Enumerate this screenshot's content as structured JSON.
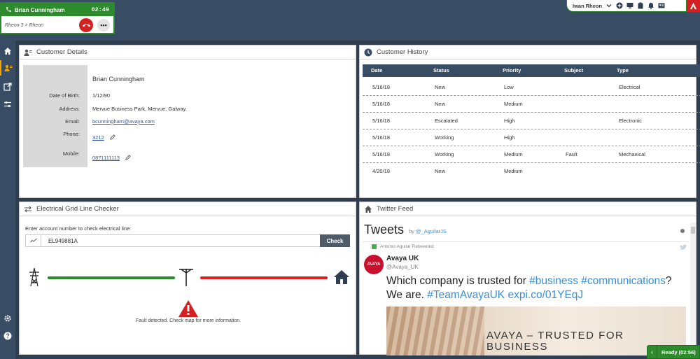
{
  "call": {
    "caller_name": "Brian Cunningham",
    "timer": "02:49",
    "route": "Rheon 3 > Rheon",
    "more_label": "•••"
  },
  "user": {
    "name": "Iwan Rheon"
  },
  "rail": {
    "items": [
      "home-icon",
      "customer-icon",
      "external-link-icon",
      "sliders-icon"
    ],
    "bottom": [
      "settings-icon",
      "help-icon"
    ]
  },
  "customer_details": {
    "title": "Customer Details",
    "name": "Brian Cunningham",
    "fields": {
      "dob_label": "Date of Birth:",
      "dob": "1/12/90",
      "address_label": "Address:",
      "address": "Mervue Business Park, Mervue, Galway.",
      "email_label": "Email:",
      "email": "bcunningham@avaya.com",
      "phone_label": "Phone:",
      "phone": "3212",
      "mobile_label": "Mobile:",
      "mobile": "0871111113"
    }
  },
  "customer_history": {
    "title": "Customer History",
    "columns": [
      "Date",
      "Status",
      "Priority",
      "Subject",
      "Type"
    ],
    "rows": [
      [
        "5/16/18",
        "New",
        "Low",
        "",
        "Electrical"
      ],
      [
        "5/16/18",
        "New",
        "Medium",
        "",
        ""
      ],
      [
        "5/16/18",
        "Escalated",
        "High",
        "",
        "Electronic"
      ],
      [
        "5/16/18",
        "Working",
        "High",
        "",
        ""
      ],
      [
        "5/16/18",
        "Working",
        "Medium",
        "Fault",
        "Mechanical"
      ],
      [
        "4/20/18",
        "New",
        "Medium",
        "",
        ""
      ]
    ]
  },
  "grid_checker": {
    "title": "Electrical Grid Line Checker",
    "prompt": "Enter account number to check electrical line:",
    "account_value": "EL949881A",
    "check_label": "Check",
    "fault_message": "Fault detected. Check map for more information.",
    "colors": {
      "ok": "#2d8a2d",
      "fault": "#e02020"
    }
  },
  "twitter": {
    "title": "Twitter Feed",
    "widget_title": "Tweets",
    "by_prefix": "by",
    "by_handle": "@_AguilarJS",
    "retweet_text": "Antonio Aguilar Retweeted",
    "author_name": "Avaya UK",
    "author_handle": "@Avaya_UK",
    "avatar_text": "AVAYA",
    "text_plain_1": "Which company is trusted for ",
    "tag_1": "#business",
    "space": " ",
    "tag_2": "#communications",
    "text_plain_2": "? We are. ",
    "tag_3": "#TeamAvayaUK",
    "link": "expi.co/01YEqJ",
    "image_caption_1": "AVAYA – TRUSTED FOR",
    "image_caption_2": "BUSINESS"
  },
  "status": {
    "ready_label": "Ready (02:56)"
  }
}
